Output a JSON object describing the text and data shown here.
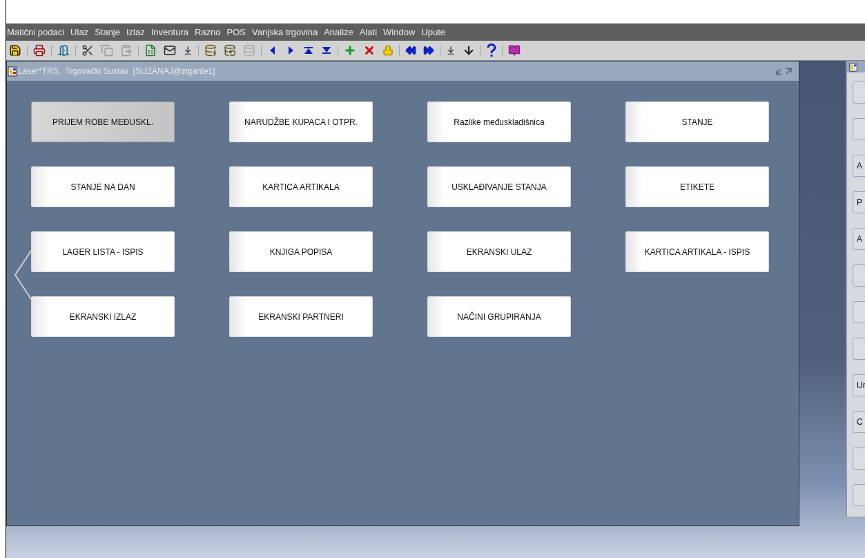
{
  "menu_bar": {
    "items": [
      "Matični podaci",
      "Ulaz",
      "Stanje",
      "Izlaz",
      "Inventura",
      "Razno",
      "POS",
      "Vanjska trgovina",
      "Analize",
      "Alati",
      "Window",
      "Upute"
    ]
  },
  "window": {
    "title": "Laser*TRS,  Trgovački Sustav  [SUZANAJ@zigante1]",
    "buttons": [
      {
        "label": "PRIJEM ROBE MEĐUSKL.",
        "selected": true
      },
      {
        "label": "NARUDŽBE KUPACA I OTPR.",
        "selected": false
      },
      {
        "label": "Razlike međuskladišnica",
        "selected": false
      },
      {
        "label": "STANJE",
        "selected": false
      },
      {
        "label": "STANJE NA DAN",
        "selected": false
      },
      {
        "label": "KARTICA ARTIKALA",
        "selected": false
      },
      {
        "label": "USKLAĐIVANJE STANJA",
        "selected": false
      },
      {
        "label": "ETIKETE",
        "selected": false
      },
      {
        "label": "LAGER LISTA - ISPIS",
        "selected": false
      },
      {
        "label": "KNJIGA POPISA",
        "selected": false
      },
      {
        "label": "EKRANSKI ULAZ",
        "selected": false
      },
      {
        "label": "KARTICA ARTIKALA - ISPIS",
        "selected": false
      },
      {
        "label": "EKRANSKI IZLAZ",
        "selected": false
      },
      {
        "label": "EKRANSKI PARTNERI",
        "selected": false
      },
      {
        "label": "NAČINI GRUPIRANJA",
        "selected": false
      }
    ]
  },
  "side_panel": {
    "buttons": [
      {
        "kind": "blank"
      },
      {
        "kind": "blank"
      },
      {
        "kind": "labeled",
        "label": "A"
      },
      {
        "kind": "labeled",
        "label": "P"
      },
      {
        "kind": "labeled",
        "label": "A"
      },
      {
        "kind": "blank"
      },
      {
        "kind": "blank"
      },
      {
        "kind": "blank"
      },
      {
        "kind": "labeled",
        "label": "Ur"
      },
      {
        "kind": "labeled",
        "label": "C"
      },
      {
        "kind": "blank"
      },
      {
        "kind": "blank"
      }
    ]
  }
}
